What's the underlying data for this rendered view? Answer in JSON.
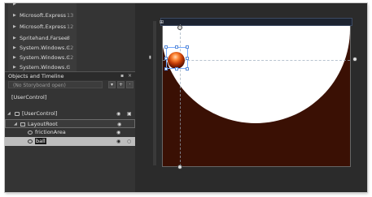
{
  "assemblies": [
    {
      "name": "Microsoft.Express",
      "count": "13"
    },
    {
      "name": "Microsoft.Express",
      "count": "12"
    },
    {
      "name": "Spritehand.Farseer",
      "count": "5"
    },
    {
      "name": "System.Windows.C",
      "count": "12"
    },
    {
      "name": "System.Windows.C",
      "count": "12"
    },
    {
      "name": "System.Windows.C",
      "count": "3"
    }
  ],
  "objects_panel": {
    "title": "Objects and Timeline",
    "storyboard_placeholder": "(No Storyboard open)",
    "options_label": "▾",
    "add_label": "+",
    "tree": [
      {
        "label": "[UserControl]"
      },
      {
        "label": "[UserControl]"
      },
      {
        "label": "LayoutRoot"
      },
      {
        "label": "frictionArea"
      },
      {
        "label": "ball"
      }
    ]
  },
  "colors": {
    "accent": "#77aaff",
    "ground": "#3a1004",
    "panel": "#343434"
  }
}
